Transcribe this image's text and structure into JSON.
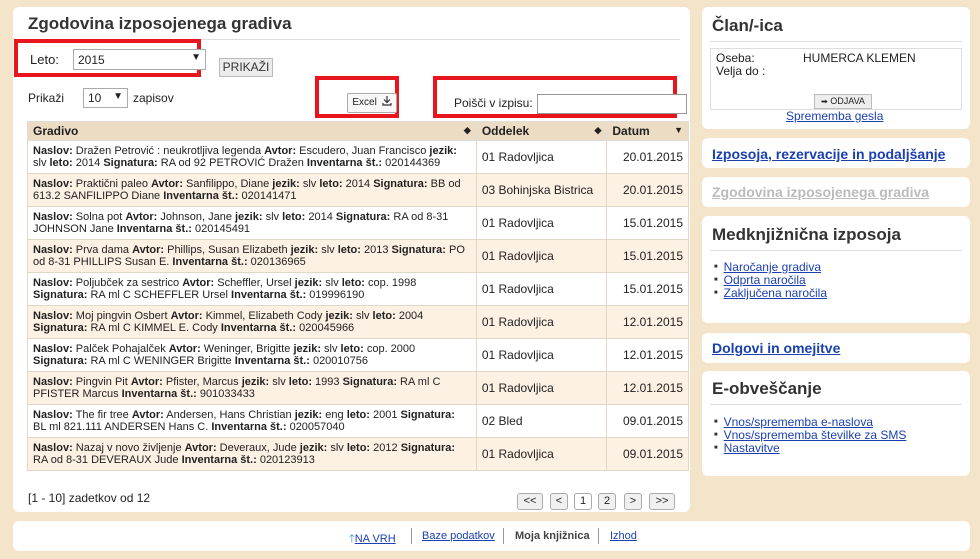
{
  "main": {
    "title": "Zgodovina izposojenega gradiva",
    "year_label": "Leto:",
    "year_value": "2015",
    "show_button": "PRIKAŽI",
    "show_label": "Prikaži",
    "page_size": "10",
    "records_label": "zapisov",
    "excel_label": "Excel",
    "search_label": "Poišči v izpisu:",
    "search_value": "",
    "columns": [
      "Gradivo",
      "Oddelek",
      "Datum"
    ],
    "rows": [
      {
        "desc": [
          [
            "b",
            "Naslov:"
          ],
          [
            "t",
            " Dražen Petrović : neukrotljiva legenda "
          ],
          [
            "b",
            "Avtor:"
          ],
          [
            "t",
            " Escudero, Juan Francisco "
          ],
          [
            "b",
            "jezik:"
          ],
          [
            "t",
            " slv "
          ],
          [
            "b",
            "leto:"
          ],
          [
            "t",
            " 2014 "
          ],
          [
            "b",
            "Signatura:"
          ],
          [
            "t",
            " RA od 92 PETROVIĆ Dražen "
          ],
          [
            "b",
            "Inventarna št.:"
          ],
          [
            "t",
            " 020144369"
          ]
        ],
        "dept": "01 Radovljica",
        "date": "20.01.2015"
      },
      {
        "desc": [
          [
            "b",
            "Naslov:"
          ],
          [
            "t",
            " Praktični paleo "
          ],
          [
            "b",
            "Avtor:"
          ],
          [
            "t",
            " Sanfilippo, Diane "
          ],
          [
            "b",
            "jezik:"
          ],
          [
            "t",
            " slv "
          ],
          [
            "b",
            "leto:"
          ],
          [
            "t",
            " 2014 "
          ],
          [
            "b",
            "Signatura:"
          ],
          [
            "t",
            " BB od 613.2 SANFILIPPO Diane "
          ],
          [
            "b",
            "Inventarna št.:"
          ],
          [
            "t",
            " 020141471"
          ]
        ],
        "dept": "03 Bohinjska Bistrica",
        "date": "20.01.2015"
      },
      {
        "desc": [
          [
            "b",
            "Naslov:"
          ],
          [
            "t",
            " Solna pot "
          ],
          [
            "b",
            "Avtor:"
          ],
          [
            "t",
            " Johnson, Jane "
          ],
          [
            "b",
            "jezik:"
          ],
          [
            "t",
            " slv "
          ],
          [
            "b",
            "leto:"
          ],
          [
            "t",
            " 2014 "
          ],
          [
            "b",
            "Signatura:"
          ],
          [
            "t",
            " RA od 8-31 JOHNSON Jane "
          ],
          [
            "b",
            "Inventarna št.:"
          ],
          [
            "t",
            " 020145491"
          ]
        ],
        "dept": "01 Radovljica",
        "date": "15.01.2015"
      },
      {
        "desc": [
          [
            "b",
            "Naslov:"
          ],
          [
            "t",
            " Prva dama "
          ],
          [
            "b",
            "Avtor:"
          ],
          [
            "t",
            " Phillips, Susan Elizabeth "
          ],
          [
            "b",
            "jezik:"
          ],
          [
            "t",
            " slv "
          ],
          [
            "b",
            "leto:"
          ],
          [
            "t",
            " 2013 "
          ],
          [
            "b",
            "Signatura:"
          ],
          [
            "t",
            " PO od 8-31 PHILLIPS Susan E. "
          ],
          [
            "b",
            "Inventarna št.:"
          ],
          [
            "t",
            " 020136965"
          ]
        ],
        "dept": "01 Radovljica",
        "date": "15.01.2015"
      },
      {
        "desc": [
          [
            "b",
            "Naslov:"
          ],
          [
            "t",
            " Poljubček za sestrico "
          ],
          [
            "b",
            "Avtor:"
          ],
          [
            "t",
            " Scheffler, Ursel "
          ],
          [
            "b",
            "jezik:"
          ],
          [
            "t",
            " slv "
          ],
          [
            "b",
            "leto:"
          ],
          [
            "t",
            " cop. 1998 "
          ],
          [
            "b",
            "Signatura:"
          ],
          [
            "t",
            " RA ml C SCHEFFLER Ursel "
          ],
          [
            "b",
            "Inventarna št.:"
          ],
          [
            "t",
            " 019996190"
          ]
        ],
        "dept": "01 Radovljica",
        "date": "15.01.2015"
      },
      {
        "desc": [
          [
            "b",
            "Naslov:"
          ],
          [
            "t",
            " Moj pingvin Osbert "
          ],
          [
            "b",
            "Avtor:"
          ],
          [
            "t",
            " Kimmel, Elizabeth Cody "
          ],
          [
            "b",
            "jezik:"
          ],
          [
            "t",
            " slv "
          ],
          [
            "b",
            "leto:"
          ],
          [
            "t",
            " 2004 "
          ],
          [
            "b",
            "Signatura:"
          ],
          [
            "t",
            " RA ml C KIMMEL E. Cody "
          ],
          [
            "b",
            "Inventarna št.:"
          ],
          [
            "t",
            " 020045966"
          ]
        ],
        "dept": "01 Radovljica",
        "date": "12.01.2015"
      },
      {
        "desc": [
          [
            "b",
            "Naslov:"
          ],
          [
            "t",
            " Palček Pohajalček "
          ],
          [
            "b",
            "Avtor:"
          ],
          [
            "t",
            " Weninger, Brigitte "
          ],
          [
            "b",
            "jezik:"
          ],
          [
            "t",
            " slv "
          ],
          [
            "b",
            "leto:"
          ],
          [
            "t",
            " cop. 2000 "
          ],
          [
            "b",
            "Signatura:"
          ],
          [
            "t",
            " RA ml C WENINGER Brigitte "
          ],
          [
            "b",
            "Inventarna št.:"
          ],
          [
            "t",
            " 020010756"
          ]
        ],
        "dept": "01 Radovljica",
        "date": "12.01.2015"
      },
      {
        "desc": [
          [
            "b",
            "Naslov:"
          ],
          [
            "t",
            " Pingvin Pit "
          ],
          [
            "b",
            "Avtor:"
          ],
          [
            "t",
            " Pfister, Marcus "
          ],
          [
            "b",
            "jezik:"
          ],
          [
            "t",
            " slv "
          ],
          [
            "b",
            "leto:"
          ],
          [
            "t",
            " 1993 "
          ],
          [
            "b",
            "Signatura:"
          ],
          [
            "t",
            " RA ml C PFISTER Marcus "
          ],
          [
            "b",
            "Inventarna št.:"
          ],
          [
            "t",
            " 901033433"
          ]
        ],
        "dept": "01 Radovljica",
        "date": "12.01.2015"
      },
      {
        "desc": [
          [
            "b",
            "Naslov:"
          ],
          [
            "t",
            " The fir tree "
          ],
          [
            "b",
            "Avtor:"
          ],
          [
            "t",
            " Andersen, Hans Christian "
          ],
          [
            "b",
            "jezik:"
          ],
          [
            "t",
            " eng "
          ],
          [
            "b",
            "leto:"
          ],
          [
            "t",
            " 2001 "
          ],
          [
            "b",
            "Signatura:"
          ],
          [
            "t",
            " BL ml 821.111 ANDERSEN Hans C. "
          ],
          [
            "b",
            "Inventarna št.:"
          ],
          [
            "t",
            " 020057040"
          ]
        ],
        "dept": "02 Bled",
        "date": "09.01.2015"
      },
      {
        "desc": [
          [
            "b",
            "Naslov:"
          ],
          [
            "t",
            " Nazaj v novo življenje "
          ],
          [
            "b",
            "Avtor:"
          ],
          [
            "t",
            " Deveraux, Jude "
          ],
          [
            "b",
            "jezik:"
          ],
          [
            "t",
            " slv "
          ],
          [
            "b",
            "leto:"
          ],
          [
            "t",
            " 2012 "
          ],
          [
            "b",
            "Signatura:"
          ],
          [
            "t",
            " RA od 8-31 DEVERAUX Jude "
          ],
          [
            "b",
            "Inventarna št.:"
          ],
          [
            "t",
            " 020123913"
          ]
        ],
        "dept": "01 Radovljica",
        "date": "09.01.2015"
      }
    ],
    "pager_info": "[1 - 10] zadetkov od 12",
    "pager": {
      "first": "<<",
      "prev": "<",
      "p1": "1",
      "p2": "2",
      "next": ">",
      "last": ">>"
    }
  },
  "member": {
    "title": "Član/-ica",
    "person_label": "Oseba:",
    "person_value": "HUMERCA KLEMEN",
    "valid_label": "Velja do :",
    "logout_label": "ODJAVA",
    "change_password": "Sprememba gesla"
  },
  "side": {
    "loans_link": "Izposoja, rezervacije in podaljšanje",
    "history_link": "Zgodovina izposojenega gradiva",
    "ill_title": "Medknjižnična izposoja",
    "ill_items": [
      "Naročanje gradiva",
      "Odprta naročila",
      "Zaključena naročila"
    ],
    "debts_link": "Dolgovi in omejitve",
    "notify_title": "E-obveščanje",
    "notify_items": [
      "Vnos/sprememba e-naslova",
      "Vnos/sprememba številke za SMS",
      "Nastavitve"
    ]
  },
  "footer": {
    "top": "NA VRH",
    "databases": "Baze podatkov",
    "my_library": "Moja knjižnica",
    "logout": "Izhod"
  },
  "colors": {
    "highlight": "#e8141e",
    "link": "#1a3fb0",
    "page_bg": "#f4e4c9"
  }
}
